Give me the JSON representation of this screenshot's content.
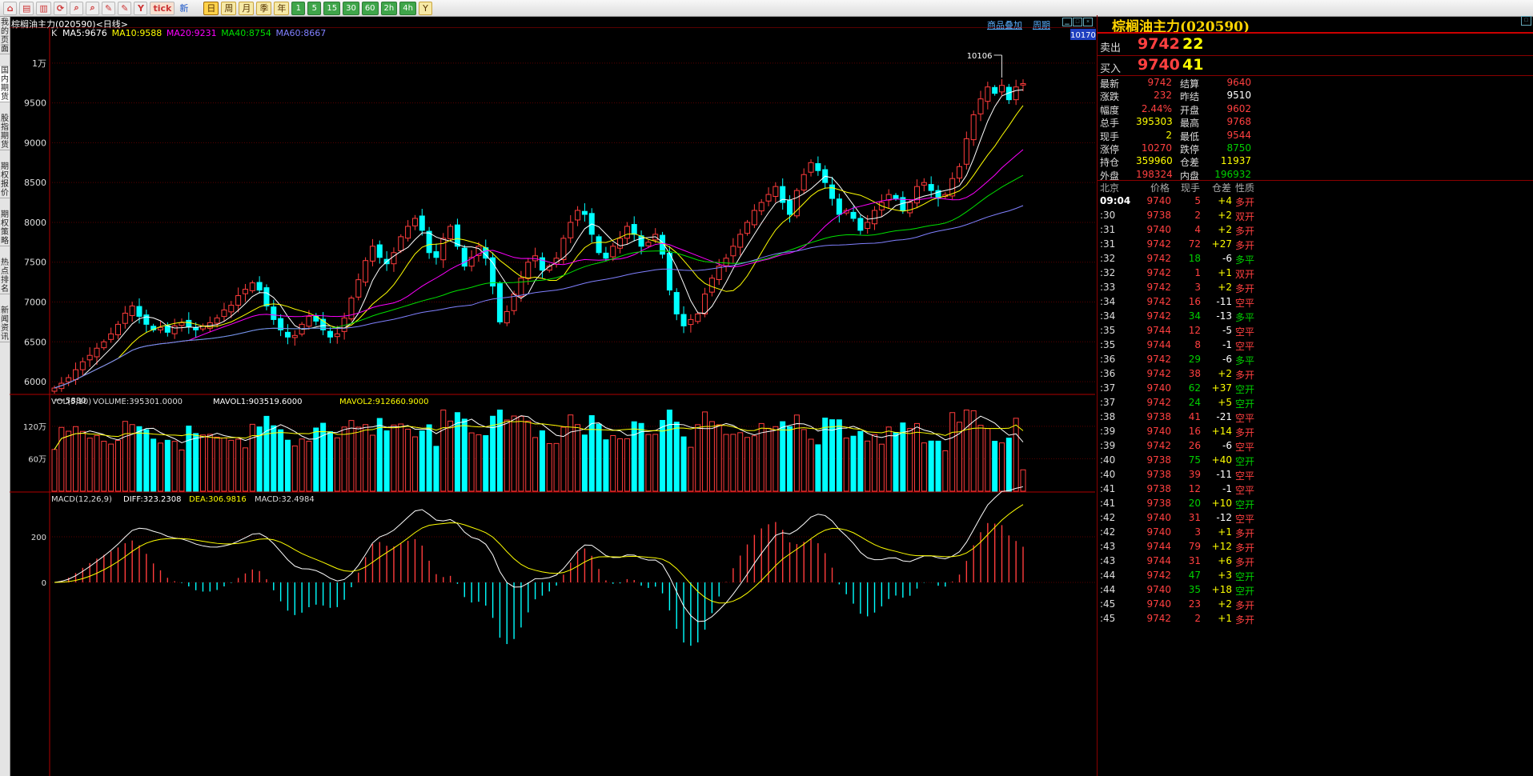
{
  "toolbar": {
    "buttons": [
      "⌂",
      "▤",
      "▥",
      "⟳",
      "⌕",
      "⌕",
      "✎",
      "✎",
      "Y"
    ],
    "tick_label": "tick",
    "new_label": "新",
    "periods": [
      "日",
      "周",
      "月",
      "季",
      "年",
      "1",
      "5",
      "15",
      "30",
      "60",
      "2h",
      "4h",
      "Y"
    ],
    "active_period": "日"
  },
  "left_tabs": [
    "我的页面",
    "国内期货",
    "股指期货",
    "期权报价",
    "期权策略",
    "热点排名",
    "新闻资讯"
  ],
  "chart_title": "棕榈油主力(020590)<日线>",
  "links": {
    "overlay": "商品叠加",
    "period": "周期"
  },
  "chart_data": {
    "type": "candlestick",
    "indicator_line": {
      "k_label": "K",
      "ma": [
        {
          "label": "MA5:9676",
          "color": "#ffffff"
        },
        {
          "label": "MA10:9588",
          "color": "#ffff00"
        },
        {
          "label": "MA20:9231",
          "color": "#ff00ff"
        },
        {
          "label": "MA40:8754",
          "color": "#00e000"
        },
        {
          "label": "MA60:8667",
          "color": "#8080ff"
        }
      ]
    },
    "price_ticks": [
      {
        "value": 10000,
        "label": "1万"
      },
      {
        "value": 9500,
        "label": "9500"
      },
      {
        "value": 9000,
        "label": "9000"
      },
      {
        "value": 8500,
        "label": "8500"
      },
      {
        "value": 8000,
        "label": "8000"
      },
      {
        "value": 7500,
        "label": "7500"
      },
      {
        "value": 7000,
        "label": "7000"
      },
      {
        "value": 6500,
        "label": "6500"
      },
      {
        "value": 6000,
        "label": "6000"
      }
    ],
    "price_range": [
      5850,
      10350
    ],
    "current_price_label": "10170",
    "high_marker": "10106",
    "low_marker": "5880",
    "closes": [
      5920,
      5980,
      6050,
      6150,
      6250,
      6330,
      6420,
      6500,
      6600,
      6720,
      6860,
      6950,
      6820,
      6720,
      6650,
      6680,
      6620,
      6700,
      6740,
      6690,
      6650,
      6700,
      6740,
      6800,
      6900,
      6960,
      7080,
      7160,
      7240,
      7150,
      6950,
      6780,
      6650,
      6560,
      6580,
      6720,
      6820,
      6760,
      6650,
      6560,
      6600,
      6800,
      7050,
      7280,
      7520,
      7700,
      7560,
      7480,
      7620,
      7820,
      7950,
      8050,
      7900,
      7620,
      7560,
      7800,
      7950,
      7700,
      7450,
      7560,
      7700,
      7550,
      7200,
      6750,
      6880,
      7100,
      7300,
      7500,
      7580,
      7400,
      7450,
      7550,
      7800,
      8000,
      8150,
      8100,
      7850,
      7620,
      7550,
      7700,
      7800,
      7950,
      7850,
      7700,
      7750,
      7850,
      7600,
      7150,
      6850,
      6700,
      6780,
      6850,
      7100,
      7300,
      7450,
      7550,
      7700,
      7850,
      8000,
      8150,
      8250,
      8350,
      8450,
      8250,
      8100,
      8400,
      8600,
      8750,
      8650,
      8500,
      8300,
      8100,
      8150,
      8050,
      7900,
      8000,
      8150,
      8250,
      8350,
      8300,
      8150,
      8250,
      8450,
      8500,
      8400,
      8300,
      8350,
      8550,
      8700,
      9050,
      9350,
      9550,
      9700,
      9620,
      9720,
      9540,
      9700,
      9742
    ],
    "macd_header": {
      "name": "MACD(12,26,9)",
      "diff": "DIFF:323.2308",
      "dea": "DEA:306.9816",
      "macd": "MACD:32.4984"
    },
    "macd_ticks": [
      {
        "value": 200,
        "label": "200"
      },
      {
        "value": 0,
        "label": "0"
      }
    ],
    "volume_header": {
      "name": "VOL(5,10)",
      "volume": "VOLUME:395301.0000",
      "mavol1": "MAVOL1:903519.6000",
      "mavol2": "MAVOL2:912660.9000"
    },
    "volume_ticks": [
      {
        "value": 1200000,
        "label": "120万"
      },
      {
        "value": 600000,
        "label": "60万"
      }
    ]
  },
  "panel": {
    "title": "棕榈油主力(020590)",
    "sell_label": "卖出",
    "sell_price": "9742",
    "sell_volume": "22",
    "buy_label": "买入",
    "buy_price": "9740",
    "buy_volume": "41",
    "quotes": [
      {
        "l": "最新",
        "v": "9742",
        "vc": "red",
        "l2": "结算",
        "v2": "9640",
        "v2c": "red"
      },
      {
        "l": "涨跌",
        "v": "232",
        "vc": "red",
        "l2": "昨结",
        "v2": "9510",
        "v2c": "white"
      },
      {
        "l": "幅度",
        "v": "2.44%",
        "vc": "red",
        "l2": "开盘",
        "v2": "9602",
        "v2c": "red"
      },
      {
        "l": "总手",
        "v": "395303",
        "vc": "yellow",
        "l2": "最高",
        "v2": "9768",
        "v2c": "red"
      },
      {
        "l": "现手",
        "v": "2",
        "vc": "yellow",
        "l2": "最低",
        "v2": "9544",
        "v2c": "red"
      },
      {
        "l": "涨停",
        "v": "10270",
        "vc": "red",
        "l2": "跌停",
        "v2": "8750",
        "v2c": "green"
      },
      {
        "l": "持仓",
        "v": "359960",
        "vc": "yellow",
        "l2": "仓差",
        "v2": "11937",
        "v2c": "yellow"
      },
      {
        "l": "外盘",
        "v": "198324",
        "vc": "red",
        "l2": "内盘",
        "v2": "196932",
        "v2c": "green"
      }
    ],
    "tick_headers": [
      "北京",
      "价格",
      "现手",
      "仓差",
      "性质"
    ],
    "ticks": [
      {
        "t": "09:04",
        "p": "9740",
        "v": "5",
        "c": "+4",
        "n": "多开"
      },
      {
        "t": ":30",
        "p": "9738",
        "v": "2",
        "c": "+2",
        "n": "双开"
      },
      {
        "t": ":31",
        "p": "9740",
        "v": "4",
        "c": "+2",
        "n": "多开"
      },
      {
        "t": ":31",
        "p": "9742",
        "v": "72",
        "c": "+27",
        "n": "多开"
      },
      {
        "t": ":32",
        "p": "9742",
        "v": "18",
        "c": "-6",
        "n": "多平"
      },
      {
        "t": ":32",
        "p": "9742",
        "v": "1",
        "c": "+1",
        "n": "双开"
      },
      {
        "t": ":33",
        "p": "9742",
        "v": "3",
        "c": "+2",
        "n": "多开"
      },
      {
        "t": ":34",
        "p": "9742",
        "v": "16",
        "c": "-11",
        "n": "空平"
      },
      {
        "t": ":34",
        "p": "9742",
        "v": "34",
        "c": "-13",
        "n": "多平"
      },
      {
        "t": ":35",
        "p": "9744",
        "v": "12",
        "c": "-5",
        "n": "空平"
      },
      {
        "t": ":35",
        "p": "9744",
        "v": "8",
        "c": "-1",
        "n": "空平"
      },
      {
        "t": ":36",
        "p": "9742",
        "v": "29",
        "c": "-6",
        "n": "多平"
      },
      {
        "t": ":36",
        "p": "9742",
        "v": "38",
        "c": "+2",
        "n": "多开"
      },
      {
        "t": ":37",
        "p": "9740",
        "v": "62",
        "c": "+37",
        "n": "空开"
      },
      {
        "t": ":37",
        "p": "9742",
        "v": "24",
        "c": "+5",
        "n": "空开"
      },
      {
        "t": ":38",
        "p": "9738",
        "v": "41",
        "c": "-21",
        "n": "空平"
      },
      {
        "t": ":39",
        "p": "9740",
        "v": "16",
        "c": "+14",
        "n": "多开"
      },
      {
        "t": ":39",
        "p": "9742",
        "v": "26",
        "c": "-6",
        "n": "空平"
      },
      {
        "t": ":40",
        "p": "9738",
        "v": "75",
        "c": "+40",
        "n": "空开"
      },
      {
        "t": ":40",
        "p": "9738",
        "v": "39",
        "c": "-11",
        "n": "空平"
      },
      {
        "t": ":41",
        "p": "9738",
        "v": "12",
        "c": "-1",
        "n": "空平"
      },
      {
        "t": ":41",
        "p": "9738",
        "v": "20",
        "c": "+10",
        "n": "空开"
      },
      {
        "t": ":42",
        "p": "9740",
        "v": "31",
        "c": "-12",
        "n": "空平"
      },
      {
        "t": ":42",
        "p": "9740",
        "v": "3",
        "c": "+1",
        "n": "多开"
      },
      {
        "t": ":43",
        "p": "9744",
        "v": "79",
        "c": "+12",
        "n": "多开"
      },
      {
        "t": ":43",
        "p": "9744",
        "v": "31",
        "c": "+6",
        "n": "多开"
      },
      {
        "t": ":44",
        "p": "9742",
        "v": "47",
        "c": "+3",
        "n": "空开"
      },
      {
        "t": ":44",
        "p": "9740",
        "v": "35",
        "c": "+18",
        "n": "空开"
      },
      {
        "t": ":45",
        "p": "9740",
        "v": "23",
        "c": "+2",
        "n": "多开"
      },
      {
        "t": ":45",
        "p": "9742",
        "v": "2",
        "c": "+1",
        "n": "多开"
      }
    ]
  }
}
